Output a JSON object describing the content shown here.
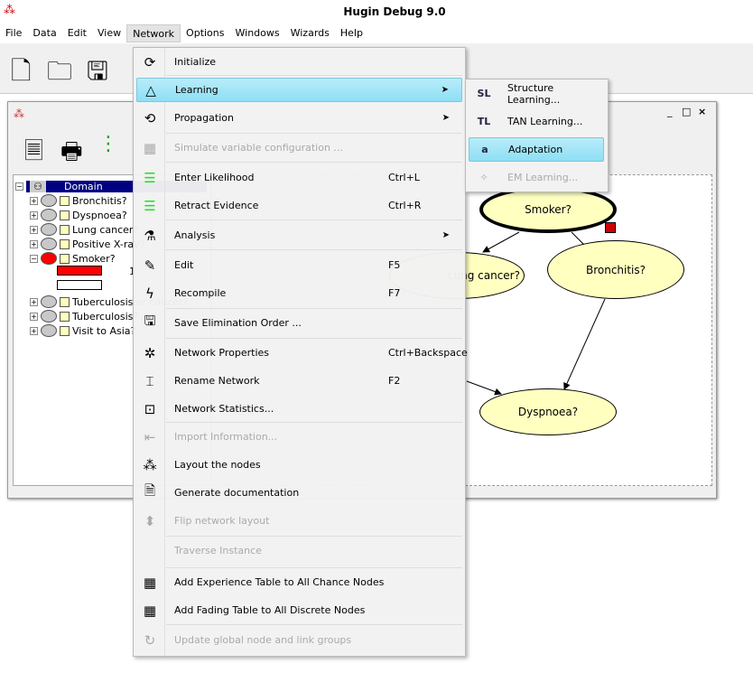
{
  "app": {
    "title": "Hugin Debug 9.0"
  },
  "menubar": [
    "File",
    "Data",
    "Edit",
    "View",
    "Network",
    "Options",
    "Windows",
    "Wizards",
    "Help"
  ],
  "tree": {
    "root": "Domain",
    "nodes": [
      "Bronchitis?",
      "Dyspnoea?",
      "Lung cancer?",
      "Positive X-ray?",
      "Smoker?",
      "Tuberculosis or cancer?",
      "Tuberculosis?",
      "Visit to Asia?"
    ],
    "smoker_state_value": "1",
    "smoker_evidence_color": "#ff0000"
  },
  "graph": {
    "nodes": [
      "Smoker?",
      "Lung cancer?",
      "Bronchitis?",
      "Dyspnoea?"
    ]
  },
  "network_menu": [
    {
      "label": "Initialize",
      "icon": "refresh-icon"
    },
    {
      "label": "Learning",
      "icon": "triangle-network-icon",
      "submenu": true,
      "highlighted": true
    },
    {
      "label": "Propagation",
      "icon": "sum-propagation-icon",
      "submenu": true
    },
    {
      "label": "Simulate variable configuration ...",
      "icon": "simulate-icon",
      "disabled": true
    },
    {
      "label": "Enter Likelihood",
      "icon": "likelihood-icon",
      "shortcut": "Ctrl+L"
    },
    {
      "label": "Retract Evidence",
      "icon": "retract-icon",
      "shortcut": "Ctrl+R"
    },
    {
      "label": "Analysis",
      "icon": "microscope-icon",
      "submenu": true
    },
    {
      "label": "Edit",
      "icon": "edit-icon",
      "shortcut": "F5"
    },
    {
      "label": "Recompile",
      "icon": "lightning-icon",
      "shortcut": "F7"
    },
    {
      "label": "Save Elimination Order ...",
      "icon": "floppy-icon"
    },
    {
      "label": "Network Properties",
      "icon": "network-icon",
      "shortcut": "Ctrl+Backspace"
    },
    {
      "label": "Rename Network",
      "icon": "rename-icon",
      "shortcut": "F2"
    },
    {
      "label": "Network Statistics...",
      "icon": "statistics-icon"
    },
    {
      "label": "Import Information...",
      "icon": "import-icon",
      "disabled": true
    },
    {
      "label": "Layout the nodes",
      "icon": "layout-icon"
    },
    {
      "label": "Generate documentation",
      "icon": "document-icon"
    },
    {
      "label": "Flip network layout",
      "icon": "flip-icon",
      "disabled": true
    },
    {
      "label": "Traverse Instance",
      "icon": "",
      "disabled": true
    },
    {
      "label": "Add Experience Table to All Chance Nodes",
      "icon": "table-icon"
    },
    {
      "label": "Add Fading Table to All Discrete Nodes",
      "icon": "table-icon"
    },
    {
      "label": "Update global node and link groups",
      "icon": "update-icon",
      "disabled": true
    }
  ],
  "learning_submenu": [
    {
      "label": "Structure Learning...",
      "icon": "SL"
    },
    {
      "label": "TAN Learning...",
      "icon": "TL"
    },
    {
      "label": "Adaptation",
      "icon": "a",
      "highlighted": true
    },
    {
      "label": "EM Learning...",
      "icon": "wand-icon",
      "disabled": true
    }
  ],
  "colors": {
    "highlight": "#a6e6f7",
    "selection": "#000080",
    "node_fill": "#ffffc0"
  }
}
